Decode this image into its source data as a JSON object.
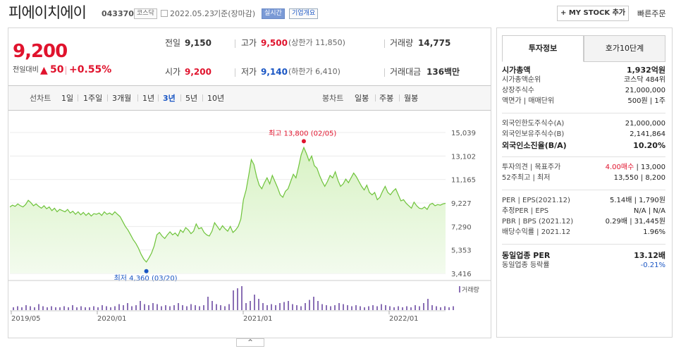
{
  "header": {
    "company": "피에이치에이",
    "code": "043370",
    "market_tag": "코스닥",
    "date": "2022.05.23",
    "date_suffix": "기준(장마감)",
    "realtime_tag": "실시간",
    "overview_tag": "기업개요",
    "mystock_button": "+ MY STOCK 추가",
    "quick_order": "빠른주문"
  },
  "price": {
    "current": "9,200",
    "change_label": "전일대비",
    "change": "50",
    "change_pct": "+0.55%",
    "prev_label": "전일",
    "prev": "9,150",
    "high_label": "고가",
    "high": "9,500",
    "upper_limit": "(상한가 11,850)",
    "volume_label": "거래량",
    "volume": "14,775",
    "open_label": "시가",
    "open": "9,200",
    "low_label": "저가",
    "low": "9,140",
    "lower_limit": "(하한가 6,410)",
    "amount_label": "거래대금",
    "amount": "136",
    "amount_unit": "백만"
  },
  "chart_tabs": {
    "line_label": "선차트",
    "periods": [
      "1일",
      "1주일",
      "3개월",
      "1년",
      "3년",
      "5년",
      "10년"
    ],
    "active_period": "3년",
    "candle_label": "봉차트",
    "candles": [
      "일봉",
      "주봉",
      "월봉"
    ]
  },
  "chart_data": {
    "type": "area",
    "y_ticks": [
      "15,039",
      "13,102",
      "11,165",
      "9,227",
      "7,290",
      "5,353",
      "3,416"
    ],
    "ylim": [
      3416,
      15039
    ],
    "x_ticks": [
      "2019/05",
      "2020/01",
      "2021/01",
      "2022/01"
    ],
    "max_annotation": "최고 13,800 (02/05)",
    "min_annotation": "최저 4,360 (03/20)",
    "volume_label": "거래량",
    "line_color": "#6ec33a",
    "fill_color": "#d8f2c4",
    "values": [
      8900,
      9050,
      8950,
      9150,
      9000,
      8900,
      9100,
      9450,
      9250,
      9000,
      9150,
      8950,
      8800,
      9000,
      8750,
      8900,
      8600,
      8800,
      8500,
      8700,
      8600,
      8500,
      8700,
      8400,
      8550,
      8300,
      8500,
      8250,
      8450,
      8200,
      8400,
      8150,
      8350,
      8300,
      8400,
      8200,
      8500,
      8300,
      8400,
      8250,
      8500,
      8300,
      8100,
      7700,
      7300,
      7000,
      6600,
      6200,
      5900,
      5500,
      5000,
      4600,
      4360,
      4700,
      5100,
      5700,
      6600,
      6800,
      6500,
      6300,
      6600,
      6850,
      6600,
      6750,
      6500,
      7000,
      6800,
      7200,
      7000,
      6700,
      6900,
      7500,
      7100,
      7200,
      6800,
      6600,
      6500,
      6900,
      7600,
      7300,
      7000,
      7350,
      7100,
      6900,
      7300,
      6800,
      7000,
      7300,
      7900,
      9500,
      10300,
      11500,
      12800,
      12400,
      11400,
      10700,
      10400,
      10900,
      11300,
      10800,
      11500,
      11000,
      10500,
      9900,
      9700,
      10200,
      10400,
      11000,
      11600,
      11300,
      12200,
      13200,
      13800,
      13300,
      12700,
      13100,
      12300,
      12100,
      11500,
      11000,
      10600,
      11000,
      11500,
      11300,
      11800,
      11100,
      10600,
      10800,
      11200,
      10900,
      11300,
      11700,
      11400,
      11000,
      10600,
      10300,
      10700,
      10100,
      9900,
      10100,
      9500,
      9700,
      10200,
      10600,
      10100,
      9900,
      10200,
      10400,
      9900,
      9400,
      9500,
      9200,
      9000,
      8800,
      9300,
      9000,
      8800,
      8750,
      8900,
      8700,
      9100,
      9200,
      9000,
      9100,
      9050,
      9150,
      9200
    ]
  },
  "right_panel": {
    "tabs": [
      "투자정보",
      "호가10단계"
    ],
    "rows": [
      {
        "label": "시가총액",
        "value": "1,932억원",
        "bold": true
      },
      {
        "label": "시가총액순위",
        "value": "코스닥 484위"
      },
      {
        "label": "상장주식수",
        "value": "21,000,000"
      },
      {
        "label": "액면가 | 매매단위",
        "value": "500원 | 1주"
      },
      {
        "label": "외국인한도주식수(A)",
        "value": "21,000,000"
      },
      {
        "label": "외국인보유주식수(B)",
        "value": "2,141,864"
      },
      {
        "label": "외국인소진율(B/A)",
        "value": "10.20%",
        "bold": true
      },
      {
        "label": "투자의견 | 목표주가",
        "value_red": "4.00매수",
        "value": " | 13,000"
      },
      {
        "label": "52주최고 | 최저",
        "value": "13,550 | 8,200"
      },
      {
        "label": "PER | EPS(2021.12)",
        "value": "5.14배 | 1,790원"
      },
      {
        "label": "추정PER | EPS",
        "value": "N/A | N/A"
      },
      {
        "label": "PBR | BPS (2021.12)",
        "value": "0.29배 | 31,445원"
      },
      {
        "label": "배당수익률 | 2021.12",
        "value": "1.96%"
      },
      {
        "label": "동일업종 PER",
        "value": "13.12배",
        "bold": true
      },
      {
        "label": "동일업종 등락률",
        "value": "-0.21%",
        "blue": true
      }
    ]
  }
}
